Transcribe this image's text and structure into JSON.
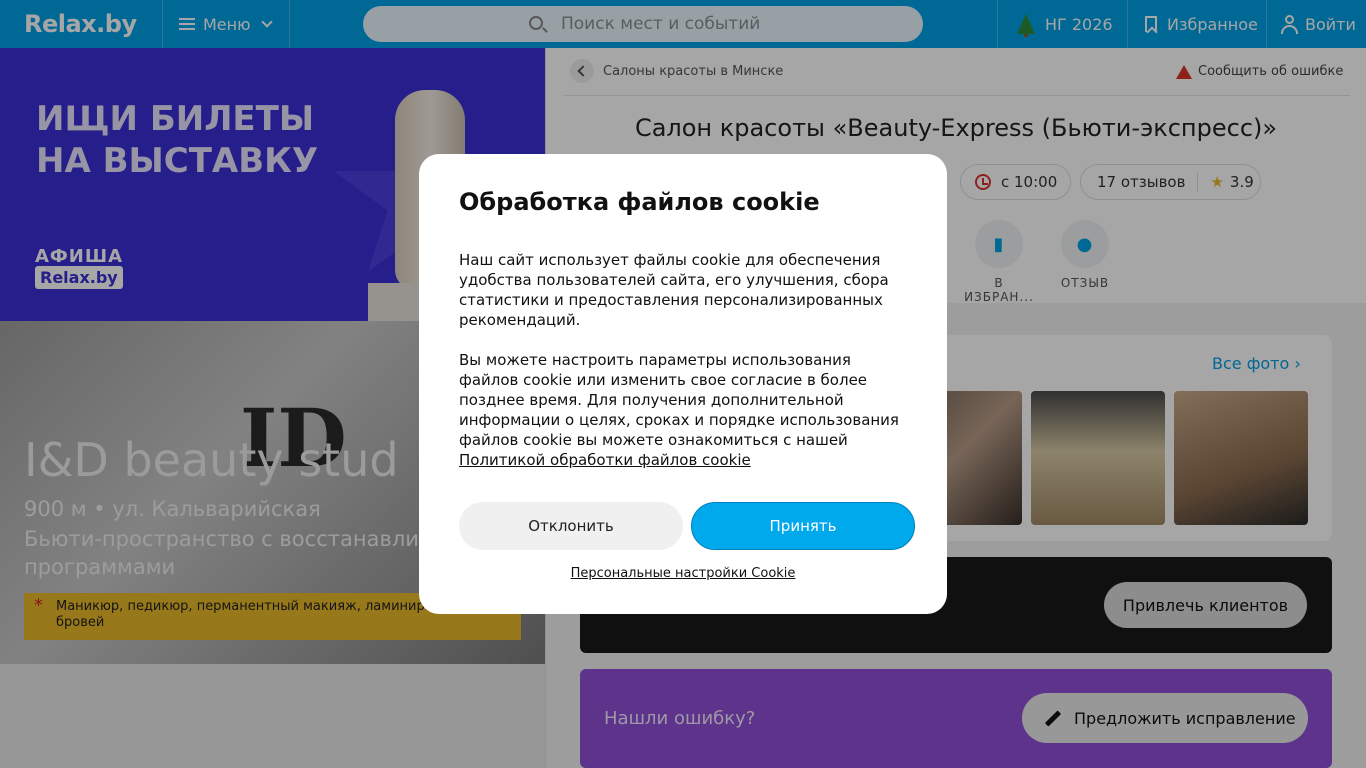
{
  "header": {
    "logo": "Relax.by",
    "menu_label": "Меню",
    "search_placeholder": "Поиск мест и событий",
    "ny_label": "НГ 2026",
    "favorites_label": "Избранное",
    "login_label": "Войти"
  },
  "banner": {
    "headline_line1": "ИЩИ БИЛЕТЫ",
    "headline_line2": "НА ВЫСТАВКУ",
    "brand_top": "АФИША",
    "brand_bottom": "Relax.by"
  },
  "ad_card": {
    "name": "I&D beauty stud",
    "distance": "900 м • ул. Кальварийская",
    "description": "Бьюти-пространство с восстанавливающими программами",
    "tags": "Маникюр, педикюр, перманентный макияж, ламинир... ресниц и бровей"
  },
  "place": {
    "breadcrumb": "Салоны красоты в Минске",
    "report_label": "Сообщить об ошибке",
    "title": "Салон красоты «Beauty-Express (Бьюти-экспресс)»",
    "hours": "с 10:00",
    "reviews": "17 отзывов",
    "rating": "3.9",
    "actions": {
      "favorite": "В ИЗБРАН...",
      "review": "ОТЗЫВ"
    },
    "all_photos": "Все фото",
    "attract_button": "Привлечь клиентов",
    "found_error": "Нашли ошибку?",
    "suggest_button": "Предложить исправление"
  },
  "cookie_modal": {
    "title": "Обработка файлов cookie",
    "paragraph1": "Наш сайт использует файлы cookie для обеспечения удобства пользователей сайта, его улучшения, сбора статистики и предоставления персонализированных рекомендаций.",
    "paragraph2": "Вы можете настроить параметры использования файлов cookie или изменить свое согласие в более позднее время. Для получения дополнительной информации о целях, сроках и порядке использования файлов cookie вы можете ознакомиться с нашей",
    "policy_link": "Политикой обработки файлов cookie",
    "decline_button": "Отклонить",
    "accept_button": "Принять",
    "settings_link": "Персональные настройки Cookie"
  },
  "colors": {
    "brand": "#00a0e3",
    "banner_bg": "#3b2fd4",
    "accent_purple": "#8f4fd6",
    "tag_yellow": "#e8b82a"
  }
}
